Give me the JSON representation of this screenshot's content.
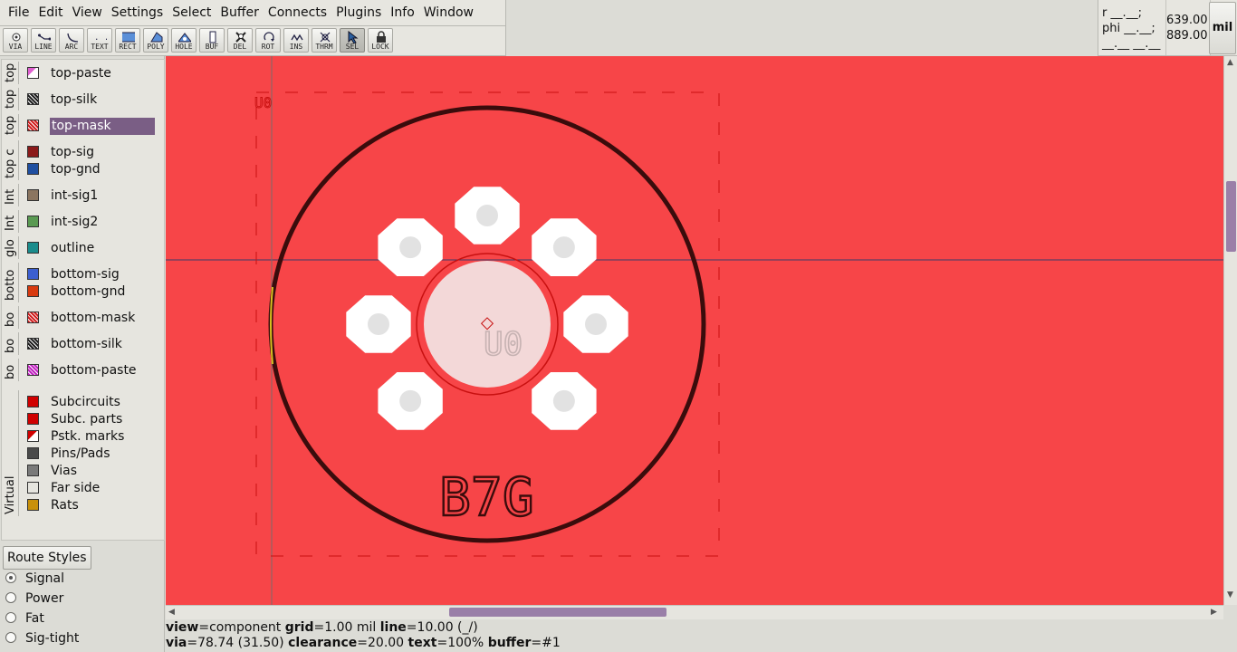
{
  "menu": [
    "File",
    "Edit",
    "View",
    "Settings",
    "Select",
    "Buffer",
    "Connects",
    "Plugins",
    "Info",
    "Window"
  ],
  "tools": [
    {
      "label": "VIA",
      "icon": "via-icon",
      "active": false
    },
    {
      "label": "LINE",
      "icon": "line-icon",
      "active": false
    },
    {
      "label": "ARC",
      "icon": "arc-icon",
      "active": false
    },
    {
      "label": "TEXT",
      "icon": "text-icon",
      "active": false
    },
    {
      "label": "RECT",
      "icon": "rect-icon",
      "active": false
    },
    {
      "label": "POLY",
      "icon": "poly-icon",
      "active": false
    },
    {
      "label": "HOLE",
      "icon": "hole-icon",
      "active": false
    },
    {
      "label": "BUF",
      "icon": "buffer-icon",
      "active": false
    },
    {
      "label": "DEL",
      "icon": "delete-icon",
      "active": false
    },
    {
      "label": "ROT",
      "icon": "rotate-icon",
      "active": false
    },
    {
      "label": "INS",
      "icon": "insert-icon",
      "active": false
    },
    {
      "label": "THRM",
      "icon": "thermal-icon",
      "active": false
    },
    {
      "label": "SEL",
      "icon": "select-icon",
      "active": true
    },
    {
      "label": "LOCK",
      "icon": "lock-icon",
      "active": false
    }
  ],
  "coords": {
    "rel_r": "r __.__;",
    "rel_phi": "phi __.__;",
    "rel_blank": "__.__ __.__",
    "abs_x": "639.00",
    "abs_y": "889.00",
    "unit": "mil"
  },
  "layer_groups": [
    {
      "tab": "top",
      "layers": [
        {
          "name": "top-paste",
          "color": "#e060d0",
          "pattern": "corner"
        }
      ]
    },
    {
      "tab": "top",
      "layers": [
        {
          "name": "top-silk",
          "color": "#202020",
          "pattern": "hatch"
        }
      ]
    },
    {
      "tab": "top",
      "layers": [
        {
          "name": "top-mask",
          "color": "#d12020",
          "pattern": "hatch",
          "selected": true
        }
      ]
    },
    {
      "tab": "top c",
      "layers": [
        {
          "name": "top-sig",
          "color": "#8b1a1a",
          "pattern": "solid"
        },
        {
          "name": "top-gnd",
          "color": "#1f4fa0",
          "pattern": "solid"
        }
      ]
    },
    {
      "tab": "Int",
      "layers": [
        {
          "name": "int-sig1",
          "color": "#8b7560",
          "pattern": "solid"
        }
      ]
    },
    {
      "tab": "Int",
      "layers": [
        {
          "name": "int-sig2",
          "color": "#5a9a52",
          "pattern": "solid"
        }
      ]
    },
    {
      "tab": "glo",
      "layers": [
        {
          "name": "outline",
          "color": "#1a8c8c",
          "pattern": "solid"
        }
      ]
    },
    {
      "tab": "botto",
      "layers": [
        {
          "name": "bottom-sig",
          "color": "#3c5fd0",
          "pattern": "solid"
        },
        {
          "name": "bottom-gnd",
          "color": "#d83a10",
          "pattern": "solid"
        }
      ]
    },
    {
      "tab": "bo",
      "layers": [
        {
          "name": "bottom-mask",
          "color": "#d12020",
          "pattern": "hatch"
        }
      ]
    },
    {
      "tab": "bo",
      "layers": [
        {
          "name": "bottom-silk",
          "color": "#202020",
          "pattern": "hatch"
        }
      ]
    },
    {
      "tab": "bo",
      "layers": [
        {
          "name": "bottom-paste",
          "color": "#c020c0",
          "pattern": "hatch"
        }
      ]
    },
    {
      "tab": "Virtual",
      "layers": [
        {
          "name": "Subcircuits",
          "color": "#d00000",
          "pattern": "solid"
        },
        {
          "name": "Subc. parts",
          "color": "#d00000",
          "pattern": "solid"
        },
        {
          "name": "Pstk. marks",
          "color": "#d00000",
          "pattern": "corner-white"
        },
        {
          "name": "Pins/Pads",
          "color": "#4a4a4a",
          "pattern": "solid"
        },
        {
          "name": "Vias",
          "color": "#7a7a7a",
          "pattern": "solid"
        },
        {
          "name": "Far side",
          "color": "#e6e5df",
          "pattern": "solid"
        },
        {
          "name": "Rats",
          "color": "#c8900a",
          "pattern": "solid"
        }
      ]
    }
  ],
  "route_styles": {
    "button": "Route Styles",
    "items": [
      {
        "name": "Signal",
        "selected": true
      },
      {
        "name": "Power",
        "selected": false
      },
      {
        "name": "Fat",
        "selected": false
      },
      {
        "name": "Sig-tight",
        "selected": false
      }
    ]
  },
  "canvas": {
    "background": "#f74548",
    "refdes_small": "U0",
    "refdes_center": "U0",
    "value_text": "B7G",
    "silk_color": "#3a0c0c",
    "pad_color": "#ffffff"
  },
  "status": {
    "line1": [
      {
        "k": "view",
        "v": "component"
      },
      {
        "k": "grid",
        "v": "1.00 mil"
      },
      {
        "k": "line",
        "v": "10.00 (_/)"
      }
    ],
    "line2": [
      {
        "k": "via",
        "v": "78.74 (31.50)"
      },
      {
        "k": "clearance",
        "v": "20.00"
      },
      {
        "k": "text",
        "v": "100%"
      },
      {
        "k": "buffer",
        "v": "#1"
      }
    ]
  }
}
